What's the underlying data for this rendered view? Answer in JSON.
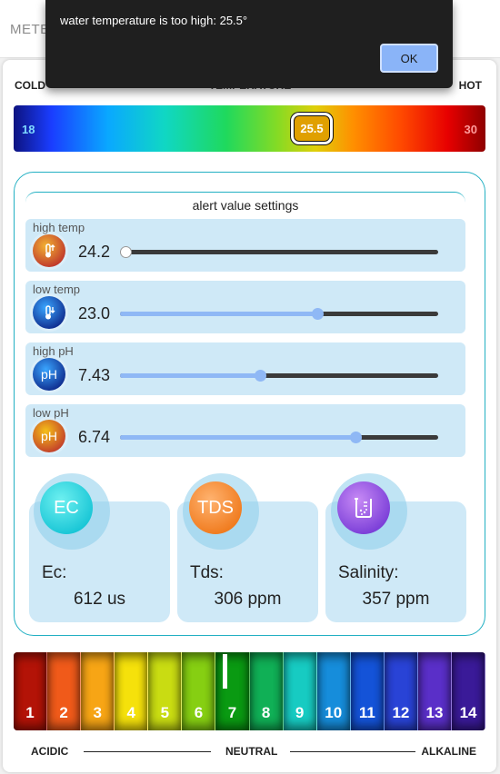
{
  "header": {
    "tab_label": "METE"
  },
  "temperature": {
    "title": "TEMPERATURE",
    "cold_label": "COLD",
    "hot_label": "HOT",
    "min": "18",
    "max": "30",
    "current": "25.5"
  },
  "alerts": {
    "title": "alert value settings",
    "items": [
      {
        "label": "high temp",
        "value": "24.2",
        "icon": "thermometer-up-icon",
        "level": 0.0
      },
      {
        "label": "low temp",
        "value": "23.0",
        "icon": "thermometer-down-icon",
        "level": 0.62
      },
      {
        "label": "high pH",
        "value": "7.43",
        "icon": "ph-icon",
        "icon_text": "pH",
        "level": 0.44
      },
      {
        "label": "low pH",
        "value": "6.74",
        "icon": "ph-icon",
        "icon_text": "pH",
        "level": 0.74
      }
    ]
  },
  "metrics": [
    {
      "badge": "EC",
      "name": "Ec:",
      "value": "612 us",
      "color": "#19c6d6"
    },
    {
      "badge": "TDS",
      "name": "Tds:",
      "value": "306 ppm",
      "color": "#f07b1e"
    },
    {
      "badge_icon": "beaker-icon",
      "name": "Salinity:",
      "value": "357 ppm",
      "color": "#7b3fd8"
    }
  ],
  "ph_scale": {
    "labels": [
      "1",
      "2",
      "3",
      "4",
      "5",
      "6",
      "7",
      "8",
      "9",
      "10",
      "11",
      "12",
      "13",
      "14"
    ],
    "colors": [
      "#b31307",
      "#f05a1a",
      "#f7a515",
      "#f5e10b",
      "#c9dc12",
      "#86cf12",
      "#0a9a12",
      "#10b056",
      "#17cbc2",
      "#168ddb",
      "#1453d8",
      "#2943d6",
      "#5a2fc8",
      "#3a1a98"
    ],
    "acidic": "ACIDIC",
    "neutral": "NEUTRAL",
    "alkaline": "ALKALINE"
  },
  "dialog": {
    "message": "water temperature is too high: 25.5°",
    "ok_label": "OK"
  }
}
